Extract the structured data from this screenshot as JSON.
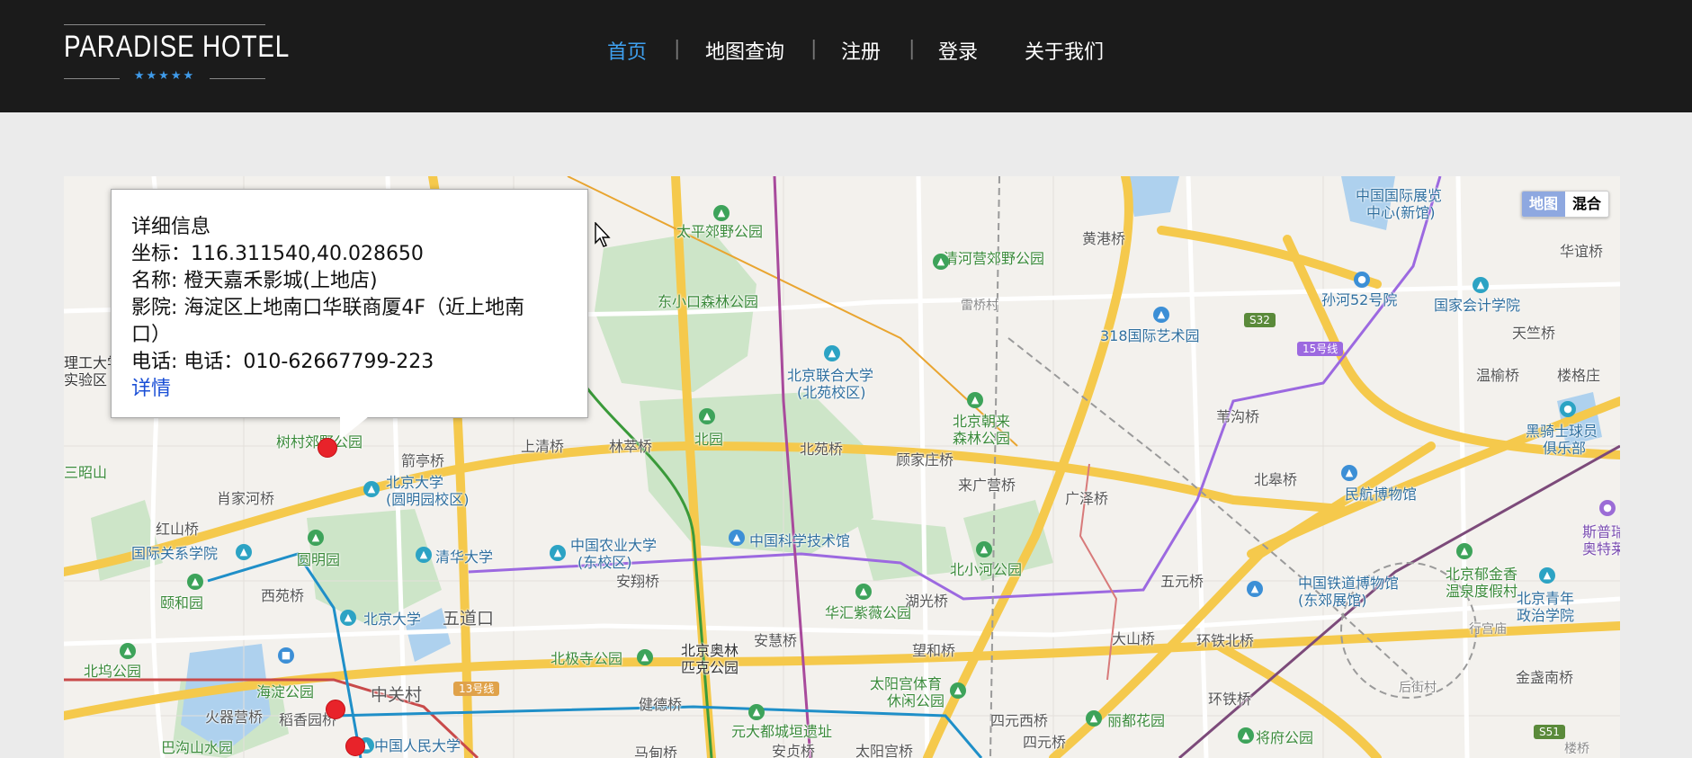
{
  "header": {
    "logo_text": "PARADISE HOTEL",
    "logo_stars": "★★★★★",
    "nav": [
      {
        "label": "首页",
        "active": true
      },
      {
        "label": "地图查询",
        "active": false
      },
      {
        "label": "注册",
        "active": false
      },
      {
        "label": "登录",
        "active": false
      },
      {
        "label": "关于我们",
        "active": false
      }
    ],
    "separator": "|"
  },
  "map": {
    "type_control": {
      "map": "地图",
      "hybrid": "混合"
    },
    "info_window": {
      "title": "详细信息",
      "coord": "坐标：116.311540,40.028650",
      "name": "名称: 橙天嘉禾影城(上地店)",
      "cinema": "影院: 海淀区上地南口华联商厦4F（近上地南口）",
      "phone": "电话: 电话：010-62667799-223",
      "more_link": "详情"
    },
    "labels": {
      "taiping": "太平郊野公园",
      "dongxiaokou": "东小口森林公园",
      "qinghe": "清河营郊野公园",
      "huangcun": "黄港桥",
      "leiqiao": "雷桥村",
      "art318": "318国际艺术园",
      "s32": "S32",
      "line15": "15号线",
      "sunhe": "孙河52号院",
      "expo": "中国国际展览",
      "expo2": "中心(新馆)",
      "audit": "国家会计学院",
      "huayi": "华谊桥",
      "tianzhu": "天竺桥",
      "wenyu": "温榆桥",
      "lougezhuang": "楼格庄",
      "beilian": "北京联合大学",
      "beilian2": "(北苑校区)",
      "beiyuan": "北园",
      "chaolai": "北京朝来",
      "chaolai2": "森林公园",
      "weigou": "苇沟桥",
      "heiqishi": "黑骑士球员",
      "heiqishi2": "俱乐部",
      "ligong": "理工大学",
      "shiyan": "实验区",
      "shucun": "树村郊野公园",
      "jianting": "箭亭桥",
      "shangqing": "上清桥",
      "linzui": "林萃桥",
      "beiyuanqiao": "北苑桥",
      "gujiazhuang": "顾家庄桥",
      "laiguangying": "来广营桥",
      "guangze": "广泽桥",
      "beigao": "北皋桥",
      "minhang": "民航博物馆",
      "sifan": "斯普瑞",
      "sifan2": "奥特莱",
      "sanzhao": "三昭山",
      "xiaojia": "肖家河桥",
      "pku_yuan": "北京大学",
      "pku_yuan2": "(圆明园校区)",
      "honghsan": "红山桥",
      "guoguan": "国际关系学院",
      "yuanmingyuan": "圆明园",
      "tsinghua": "清华大学",
      "cau": "中国农业大学",
      "cau2": "(东校区)",
      "kejiguan": "中国科学技术馆",
      "beixiaohe": "北小河公园",
      "wuyuan": "五元桥",
      "railway": "中国铁道博物馆",
      "railway2": "(东郊展馆)",
      "yujinxiang": "北京郁金香",
      "yujinxiang2": "温泉度假村",
      "youth": "北京青年",
      "youth2": "政治学院",
      "xingonggong": "行宫庙",
      "yiheyuan": "颐和园",
      "xiyuan": "西苑桥",
      "pku": "北京大学",
      "wudaokou": "五道口",
      "anxiang": "安翔桥",
      "olympic": "北京奥林",
      "olympic2": "匹克公园",
      "huabei": "华汇紫薇公园",
      "huguang": "湖光桥",
      "dashan": "大山桥",
      "huantie": "环铁北桥",
      "jinzhan": "金盏南桥",
      "beiwu": "北坞公园",
      "haidian": "海淀公园",
      "zhongguancun": "中关村",
      "line13": "13号线",
      "beiji": "北极寺公园",
      "anhui": "安慧桥",
      "wanghe": "望和桥",
      "taiyanggong": "太阳宫体育",
      "taiyanggong2": "休闲公园",
      "huanqiao": "环铁桥",
      "houjie": "后街村",
      "huoqi": "火器营桥",
      "daoxiang": "稻香园桥",
      "jiande": "健德桥",
      "yuandadu": "元大都城垣遗址",
      "siyuanxi": "四元西桥",
      "lidu": "丽都花园",
      "jiangfu": "将府公园",
      "bagou": "巴沟山水园",
      "renmin": "中国人民大学",
      "anzhen": "安贞桥",
      "taiyang": "太阳宫桥",
      "siyuan": "四元桥",
      "madian": "马甸桥",
      "s51": "S51",
      "loug": "楼桥"
    }
  }
}
